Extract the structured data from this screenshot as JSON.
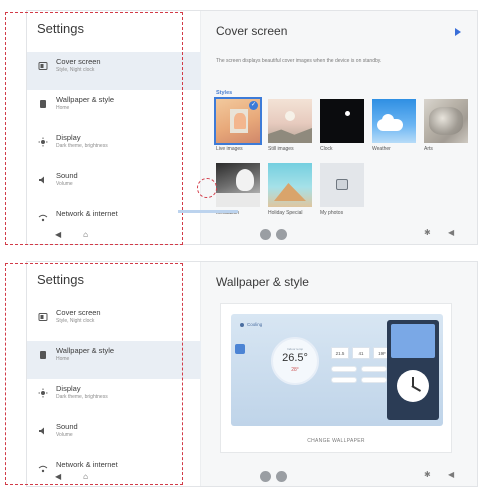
{
  "sidebar": {
    "title": "Settings",
    "items": [
      {
        "label": "Cover screen",
        "sub": "Style, Night clock",
        "icon": "cover-screen-icon"
      },
      {
        "label": "Wallpaper & style",
        "sub": "Home",
        "icon": "wallpaper-icon"
      },
      {
        "label": "Display",
        "sub": "Dark theme, brightness",
        "icon": "brightness-icon"
      },
      {
        "label": "Sound",
        "sub": "Volume",
        "icon": "speaker-icon"
      },
      {
        "label": "Network & internet",
        "sub": "",
        "icon": "wifi-icon"
      }
    ],
    "nav": {
      "back": "◀",
      "home": "⌂"
    }
  },
  "screen1": {
    "active_item": "Cover screen",
    "title": "Cover screen",
    "description": "The screen displays beautiful cover images when the device is on standby.",
    "styles_heading": "Styles",
    "styles": [
      {
        "label": "Live images",
        "selected": true
      },
      {
        "label": "Still images",
        "selected": false
      },
      {
        "label": "Clock",
        "selected": false
      },
      {
        "label": "Weather",
        "selected": false
      },
      {
        "label": "Arts",
        "selected": false
      },
      {
        "label": "Meditation",
        "selected": false
      },
      {
        "label": "Holiday Special",
        "selected": false
      },
      {
        "label": "My photos",
        "selected": false
      }
    ]
  },
  "screen2": {
    "active_item": "Wallpaper & style",
    "title": "Wallpaper & style",
    "preview": {
      "app_label": "Cooling",
      "temp_caption": "Indoor temp",
      "temp_value": "26.5°",
      "set_temp": "28°",
      "readings": [
        "21.5",
        "41",
        "19F"
      ]
    },
    "change_wallpaper": "CHANGE WALLPAPER"
  },
  "colors": {
    "accent": "#3d7bd8",
    "highlight_dash": "#d23b48",
    "active_row": "#e9eef4"
  }
}
